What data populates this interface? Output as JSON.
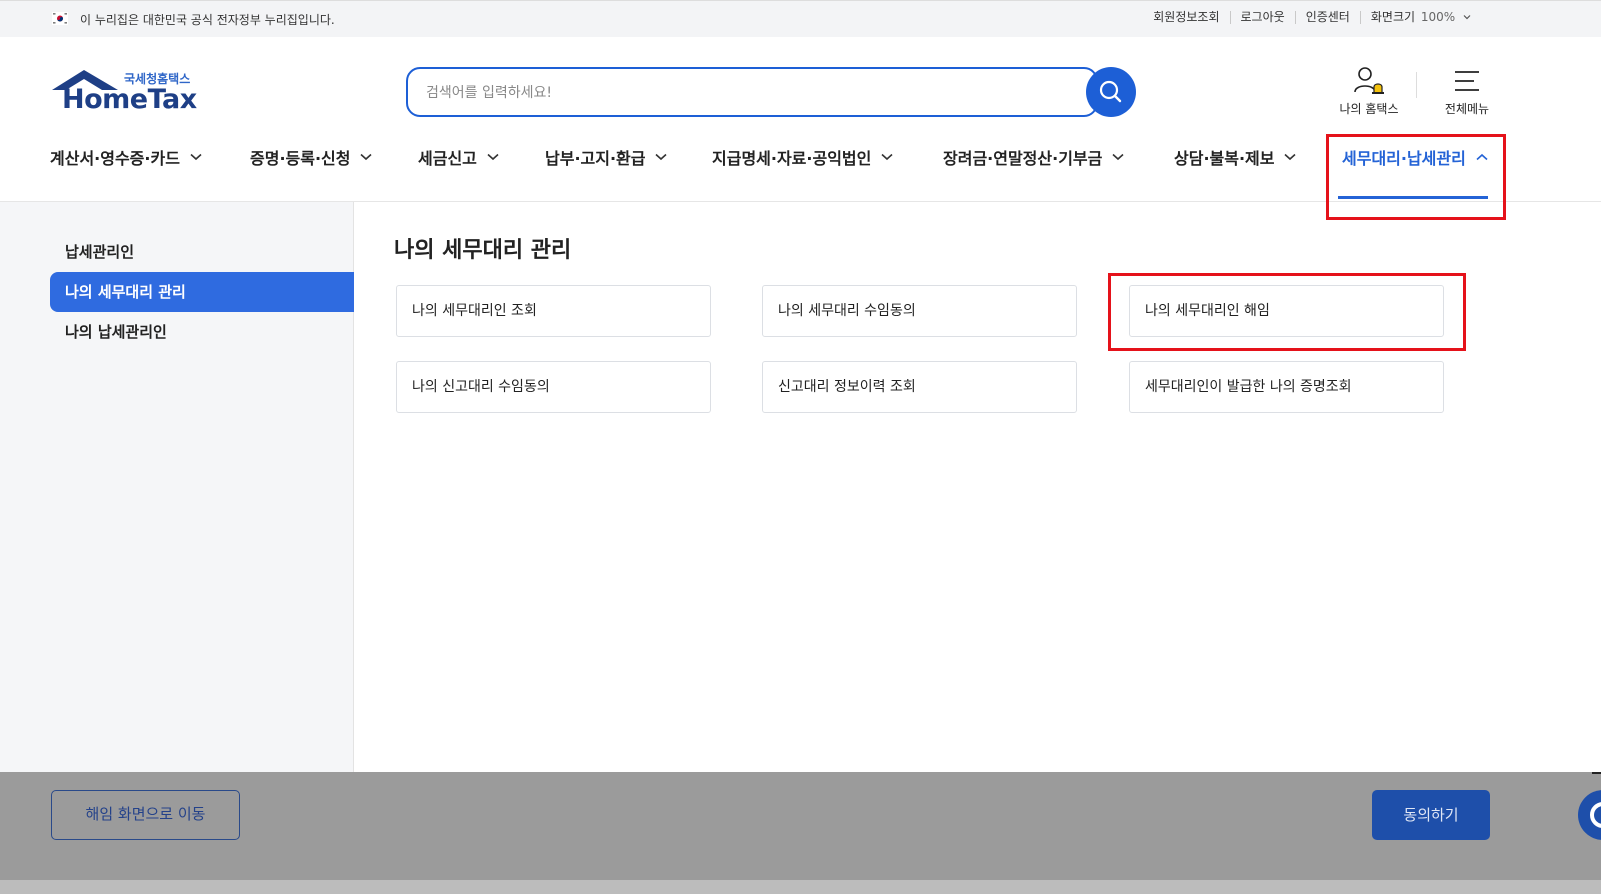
{
  "gov_banner": {
    "notice": "이 누리집은 대한민국 공식 전자정부 누리집입니다."
  },
  "utility_links": {
    "member_info": "회원정보조회",
    "logout": "로그아웃",
    "cert_center": "인증센터",
    "screen_size": "화면크기",
    "zoom_value": "100%"
  },
  "logo": {
    "tagline": "국세청홈택스",
    "wordmark": "HomeTax"
  },
  "search": {
    "placeholder": "검색어를 입력하세요!"
  },
  "header_icons": {
    "my_hometax": "나의 홈택스",
    "all_menu": "전체메뉴"
  },
  "nav": {
    "items": [
      {
        "label": "계산서·영수증·카드"
      },
      {
        "label": "증명·등록·신청"
      },
      {
        "label": "세금신고"
      },
      {
        "label": "납부·고지·환급"
      },
      {
        "label": "지급명세·자료·공익법인"
      },
      {
        "label": "장려금·연말정산·기부금"
      },
      {
        "label": "상담·불복·제보"
      },
      {
        "label": "세무대리·납세관리"
      }
    ],
    "active_index": 7
  },
  "sidebar": {
    "items": [
      {
        "label": "납세관리인"
      },
      {
        "label": "나의 세무대리 관리"
      },
      {
        "label": "나의 납세관리인"
      }
    ],
    "active_index": 1
  },
  "main": {
    "title": "나의 세무대리 관리",
    "cards": [
      {
        "label": "나의 세무대리인 조회"
      },
      {
        "label": "나의 세무대리 수임동의"
      },
      {
        "label": "나의 세무대리인 해임"
      },
      {
        "label": "나의 신고대리 수임동의"
      },
      {
        "label": "신고대리 정보이력 조회"
      },
      {
        "label": "세무대리인이 발급한 나의 증명조회"
      }
    ]
  },
  "bottom_bar": {
    "left_button": "해임 화면으로 이동",
    "right_button": "동의하기"
  },
  "colors": {
    "accent": "#2463d6",
    "highlight": "#e5121a",
    "overlay": "#9b9b9b"
  }
}
